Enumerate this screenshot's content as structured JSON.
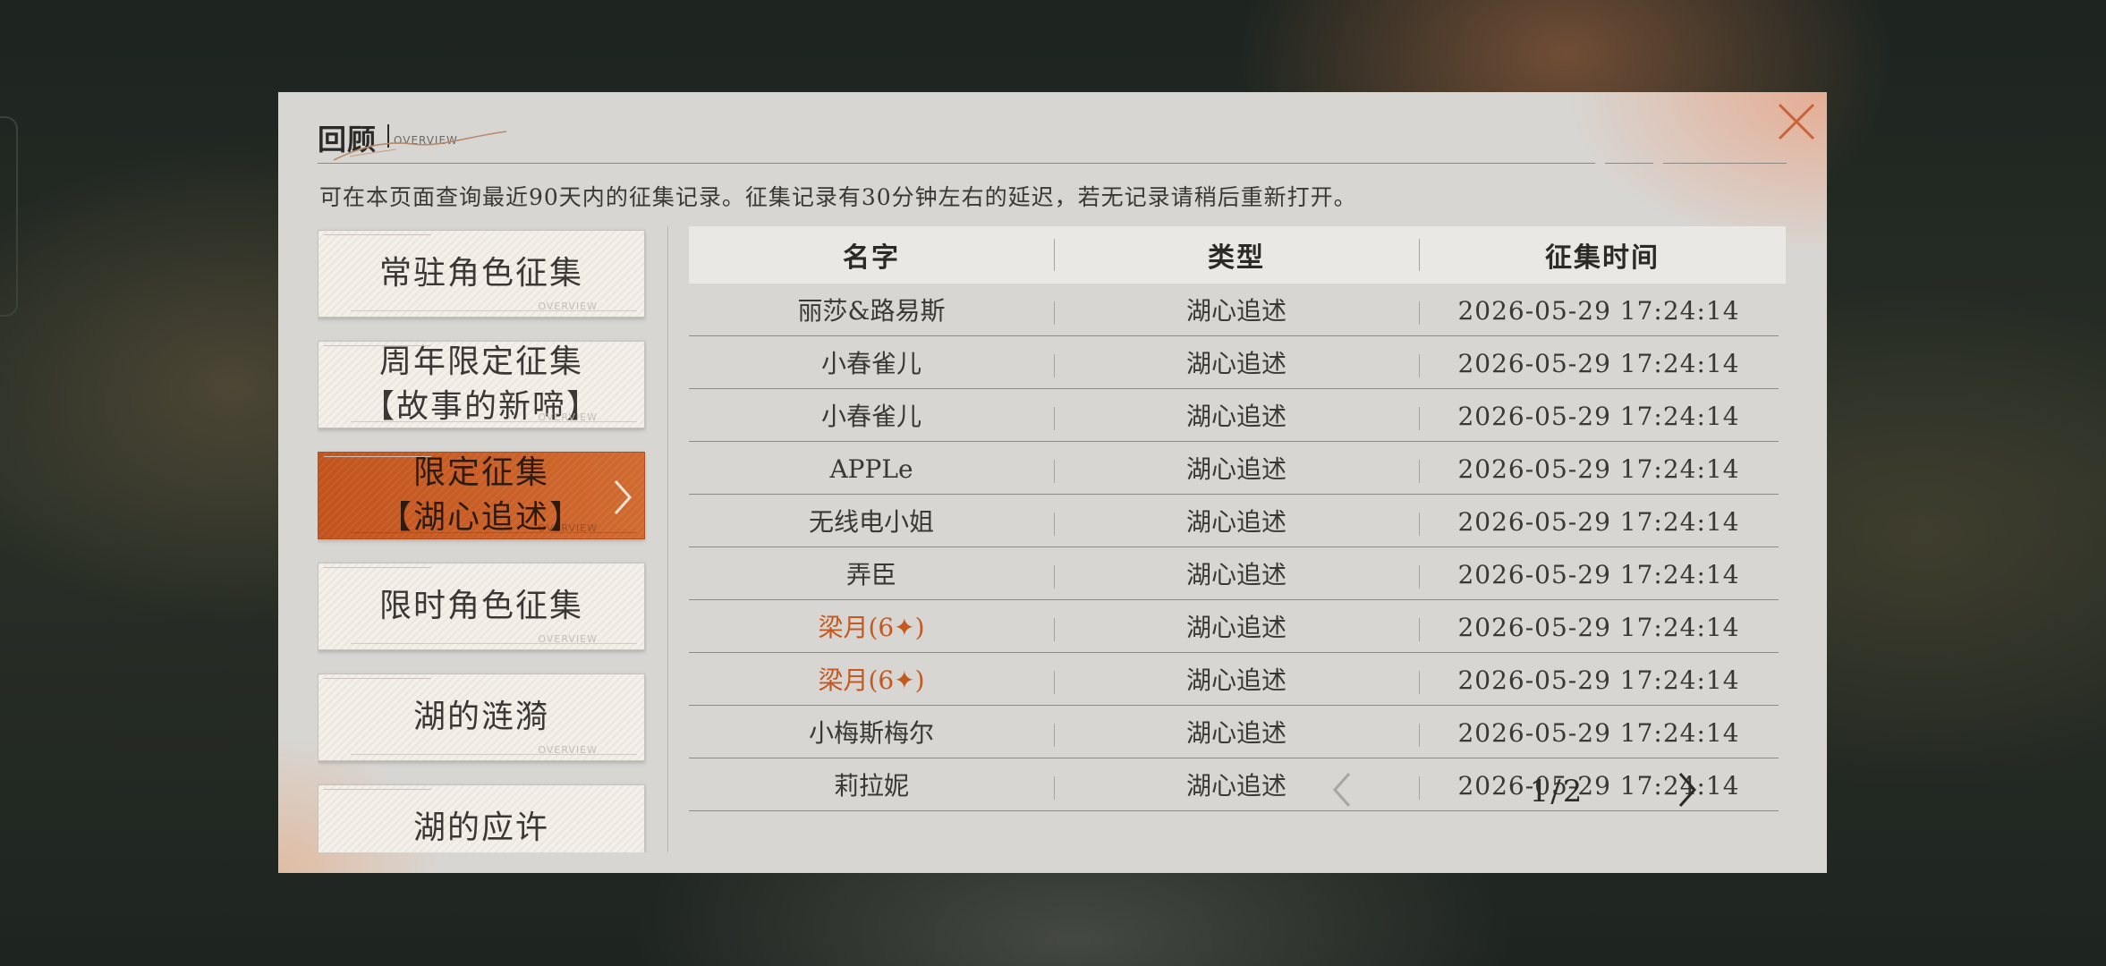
{
  "dialog": {
    "title": "回顾",
    "title_sub": "OVERVIEW",
    "notice": "可在本页面查询最近90天内的征集记录。征集记录有30分钟左右的延迟，若无记录请稍后重新打开。"
  },
  "categories": [
    {
      "line1": "常驻角色征集",
      "line2": "",
      "active": false
    },
    {
      "line1": "周年限定征集",
      "line2": "【故事的新啼】",
      "active": false
    },
    {
      "line1": "限定征集",
      "line2": "【湖心追述】",
      "active": true
    },
    {
      "line1": "限时角色征集",
      "line2": "",
      "active": false
    },
    {
      "line1": "湖的涟漪",
      "line2": "",
      "active": false
    },
    {
      "line1": "湖的应许",
      "line2": "",
      "active": false
    }
  ],
  "card_deco": {
    "ov": "OVERVIEW",
    "mark": "◇"
  },
  "table": {
    "headers": {
      "name": "名字",
      "type": "类型",
      "time": "征集时间"
    },
    "rows": [
      {
        "name": "丽莎&路易斯",
        "type": "湖心追述",
        "time": "2026-05-29 17:24:14",
        "highlight": false
      },
      {
        "name": "小春雀儿",
        "type": "湖心追述",
        "time": "2026-05-29 17:24:14",
        "highlight": false
      },
      {
        "name": "小春雀儿",
        "type": "湖心追述",
        "time": "2026-05-29 17:24:14",
        "highlight": false
      },
      {
        "name": "APPLe",
        "type": "湖心追述",
        "time": "2026-05-29 17:24:14",
        "highlight": false
      },
      {
        "name": "无线电小姐",
        "type": "湖心追述",
        "time": "2026-05-29 17:24:14",
        "highlight": false
      },
      {
        "name": "弄臣",
        "type": "湖心追述",
        "time": "2026-05-29 17:24:14",
        "highlight": false
      },
      {
        "name": "梁月(6✦)",
        "type": "湖心追述",
        "time": "2026-05-29 17:24:14",
        "highlight": true
      },
      {
        "name": "梁月(6✦)",
        "type": "湖心追述",
        "time": "2026-05-29 17:24:14",
        "highlight": true
      },
      {
        "name": "小梅斯梅尔",
        "type": "湖心追述",
        "time": "2026-05-29 17:24:14",
        "highlight": false
      },
      {
        "name": "莉拉妮",
        "type": "湖心追述",
        "time": "2026-05-29 17:24:14",
        "highlight": false
      }
    ]
  },
  "pager": {
    "text": "1/2"
  },
  "icons": {
    "close": "close-icon",
    "prev": "chevron-left-icon",
    "next": "chevron-right-icon",
    "active_arrow": "chevron-right-icon"
  },
  "colors": {
    "accent": "#c4581f",
    "active_bg": "#c9561f",
    "dialog_bg": "#d8d6d3"
  }
}
